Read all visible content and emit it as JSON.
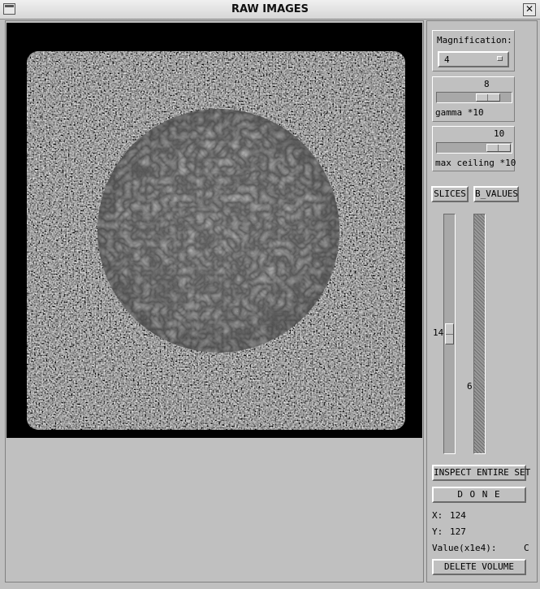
{
  "window": {
    "title": "RAW IMAGES"
  },
  "magnification": {
    "label": "Magnification:",
    "value": "4"
  },
  "gamma": {
    "value": "8",
    "label": "gamma *10",
    "fraction": 0.8
  },
  "max_ceiling": {
    "value": "10",
    "label": "max ceiling *10",
    "fraction": 1.0
  },
  "buttons": {
    "slices": "SLICES",
    "b_values": "B_VALUES",
    "inspect": "INSPECT ENTIRE SET",
    "done": "D O N E",
    "delete": "DELETE VOLUME"
  },
  "slice_slider": {
    "value": "14",
    "fraction": 0.5
  },
  "bvalue_slider": {
    "value": "6"
  },
  "readout": {
    "x_label": "X:",
    "x_value": "124",
    "y_label": "Y:",
    "y_value": "127",
    "value_label": "Value(x1e4):",
    "value_value": "C"
  },
  "icons": {
    "window_menu": "window-menu-icon",
    "close": "close-icon",
    "dropdown": "dropdown-arrow-icon"
  }
}
